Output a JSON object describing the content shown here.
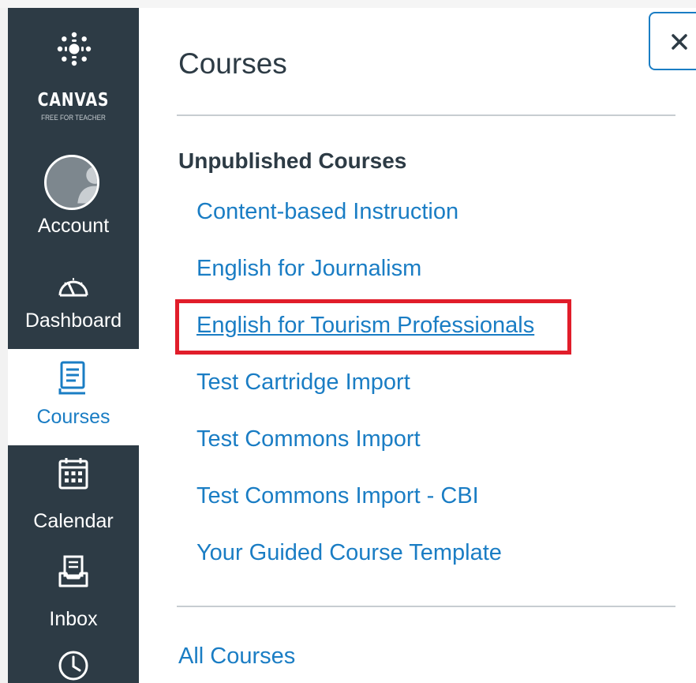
{
  "brand": {
    "name": "CANVAS",
    "tagline": "FREE FOR TEACHER"
  },
  "global_nav": {
    "items": [
      {
        "label": "Account",
        "icon": "avatar",
        "active": false
      },
      {
        "label": "Dashboard",
        "icon": "dashboard-gauge-icon",
        "active": false
      },
      {
        "label": "Courses",
        "icon": "courses-book-icon",
        "active": true
      },
      {
        "label": "Calendar",
        "icon": "calendar-icon",
        "active": false
      },
      {
        "label": "Inbox",
        "icon": "inbox-icon",
        "active": false
      },
      {
        "label": "",
        "icon": "history-clock-icon",
        "active": false
      }
    ]
  },
  "tray": {
    "title": "Courses",
    "close_label": "×",
    "section_heading": "Unpublished Courses",
    "courses": [
      {
        "name": "Content-based Instruction"
      },
      {
        "name": "English for Journalism"
      },
      {
        "name": "English for Tourism Professionals",
        "highlighted": true
      },
      {
        "name": "Test Cartridge Import"
      },
      {
        "name": "Test Commons Import"
      },
      {
        "name": "Test Commons Import - CBI"
      },
      {
        "name": "Your Guided Course Template"
      }
    ],
    "all_courses_label": "All Courses"
  },
  "colors": {
    "nav_background": "#2d3b45",
    "link": "#1a7dc4",
    "highlight": "#e11d2a",
    "text": "#2d3b45"
  }
}
